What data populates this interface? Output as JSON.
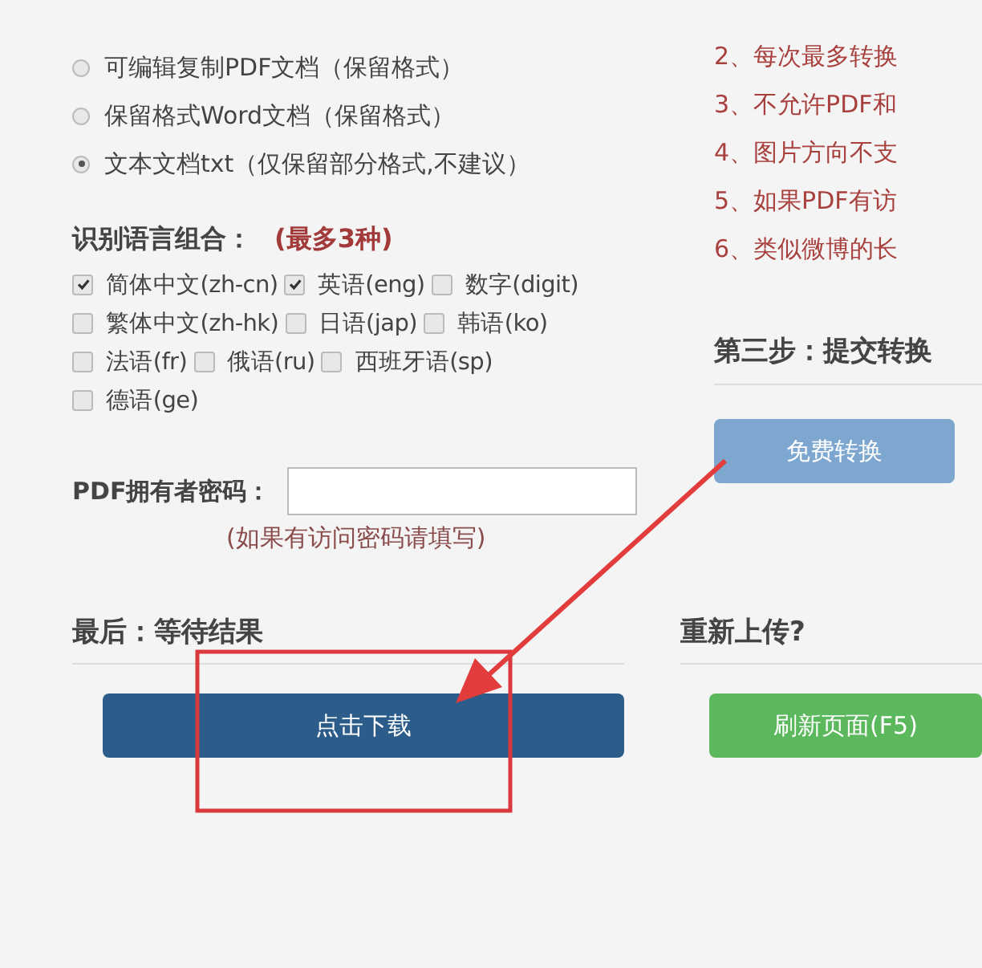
{
  "result_options": {
    "options": [
      {
        "label": "可编辑复制PDF文档（保留格式）",
        "selected": false
      },
      {
        "label": "保留格式Word文档（保留格式）",
        "selected": false
      },
      {
        "label": "文本文档txt（仅保留部分格式,不建议）",
        "selected": true
      }
    ]
  },
  "languages": {
    "title": "识别语言组合：",
    "note": "(最多3种)",
    "rows": [
      [
        {
          "label": "简体中文(zh-cn)",
          "checked": true
        },
        {
          "label": "英语(eng)",
          "checked": true
        },
        {
          "label": "数字(digit)",
          "checked": false
        }
      ],
      [
        {
          "label": "繁体中文(zh-hk)",
          "checked": false
        },
        {
          "label": "日语(jap)",
          "checked": false
        },
        {
          "label": "韩语(ko)",
          "checked": false
        }
      ],
      [
        {
          "label": "法语(fr)",
          "checked": false
        },
        {
          "label": "俄语(ru)",
          "checked": false
        },
        {
          "label": "西班牙语(sp)",
          "checked": false
        }
      ],
      [
        {
          "label": "德语(ge)",
          "checked": false
        }
      ]
    ]
  },
  "password": {
    "label": "PDF拥有者密码：",
    "hint": "(如果有访问密码请填写)"
  },
  "notes": [
    "2、每次最多转换",
    "3、不允许PDF和",
    "4、图片方向不支",
    "5、如果PDF有访",
    "6、类似微博的长"
  ],
  "step3": {
    "title": "第三步：提交转换",
    "button": "免费转换"
  },
  "final": {
    "title": "最后：等待结果",
    "button": "点击下载"
  },
  "reupload": {
    "title": "重新上传?",
    "button": "刷新页面(F5)"
  }
}
